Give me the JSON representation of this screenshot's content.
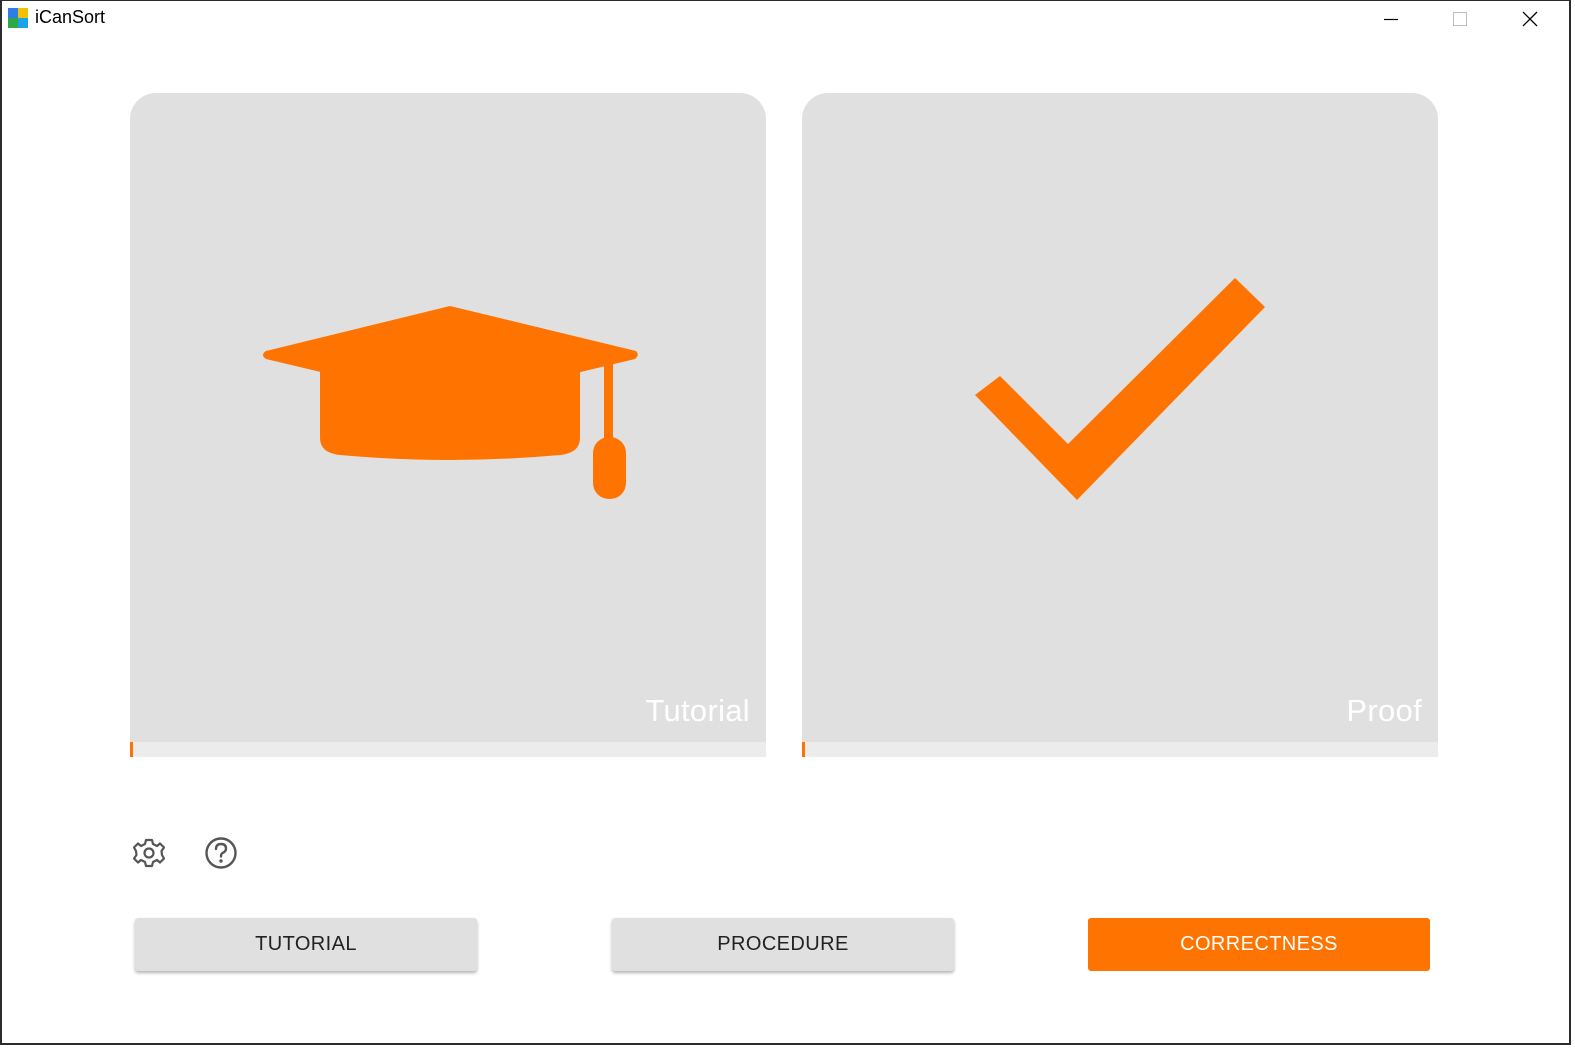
{
  "window": {
    "title": "iCanSort",
    "controls": {
      "minimize_icon": "minimize-icon",
      "maximize_icon": "maximize-icon",
      "close_icon": "close-icon"
    }
  },
  "cards": [
    {
      "caption": "Tutorial",
      "icon": "graduation-cap-icon"
    },
    {
      "caption": "Proof",
      "icon": "checkmark-icon"
    }
  ],
  "toolbar": {
    "settings_icon": "gear-icon",
    "help_icon": "help-icon"
  },
  "buttons": {
    "tutorial_label": "TUTORIAL",
    "procedure_label": "PROCEDURE",
    "correctness_label": "CORRECTNESS"
  },
  "colors": {
    "accent": "#ff7300",
    "card_background": "#e0e0e0",
    "button_background": "#e0e0e0"
  }
}
